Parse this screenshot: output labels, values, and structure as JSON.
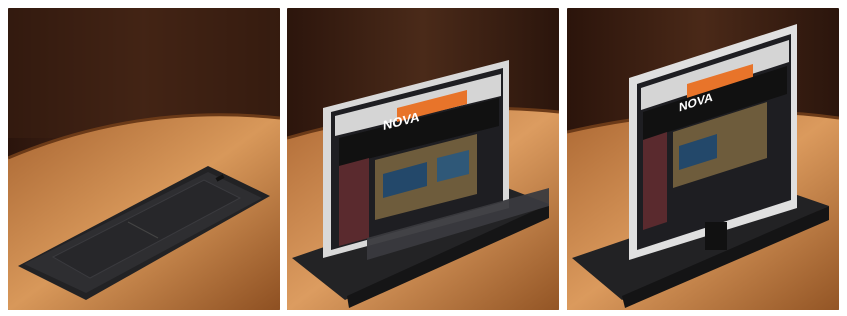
{
  "image": {
    "panels": [
      {
        "name": "panel-closed",
        "state": "lift retracted, lid closed"
      },
      {
        "name": "panel-rising",
        "state": "monitor rising from desk"
      },
      {
        "name": "panel-raised",
        "state": "monitor fully raised"
      }
    ],
    "screen": {
      "logo_text": "NOVA",
      "banner_colors": [
        "#e8742a",
        "#cfcfcf"
      ]
    },
    "colors": {
      "wall": "#3a1f14",
      "desk": "#c8874a",
      "device": "#2a2a2c"
    }
  }
}
